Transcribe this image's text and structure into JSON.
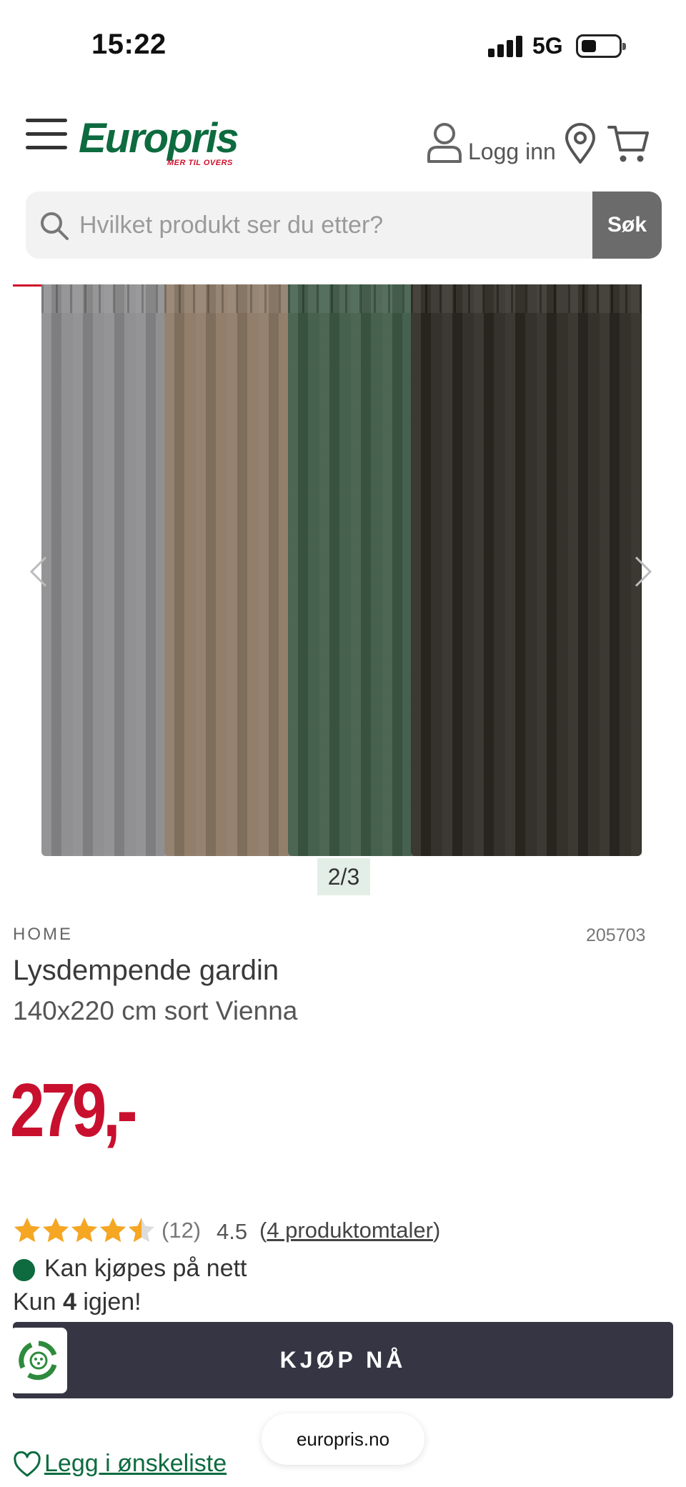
{
  "status_bar": {
    "time": "15:22",
    "network": "5G"
  },
  "header": {
    "logo_text": "Europris",
    "logo_tagline": "MER TIL OVERS",
    "login_label": "Logg inn"
  },
  "search": {
    "placeholder": "Hvilket produkt ser du etter?",
    "button_label": "Søk"
  },
  "gallery": {
    "counter": "2/3",
    "curtain_colors": [
      "#8c8c8e",
      "#8d7a66",
      "#3f5b47",
      "#2d2923"
    ]
  },
  "product": {
    "brand": "HOME",
    "sku": "205703",
    "title": "Lysdempende gardin",
    "subtitle": "140x220 cm sort Vienna",
    "price": "279,-",
    "rating": {
      "stars": 4.5,
      "count": "(12)",
      "value": "4.5",
      "reviews_open": "(",
      "reviews_link": "4 produktomtaler",
      "reviews_close": ")"
    },
    "availability": "Kan kjøpes på nett",
    "stock_prefix": "Kun",
    "stock_count": "4",
    "stock_suffix": "igjen!",
    "buy_button": "KJØP NÅ",
    "wishlist": "Legg i ønskeliste"
  },
  "browser": {
    "url": "europris.no"
  },
  "colors": {
    "brand_green": "#0d6b3f",
    "price_red": "#c8102e",
    "buy_button": "#353544",
    "star": "#f5a623"
  }
}
